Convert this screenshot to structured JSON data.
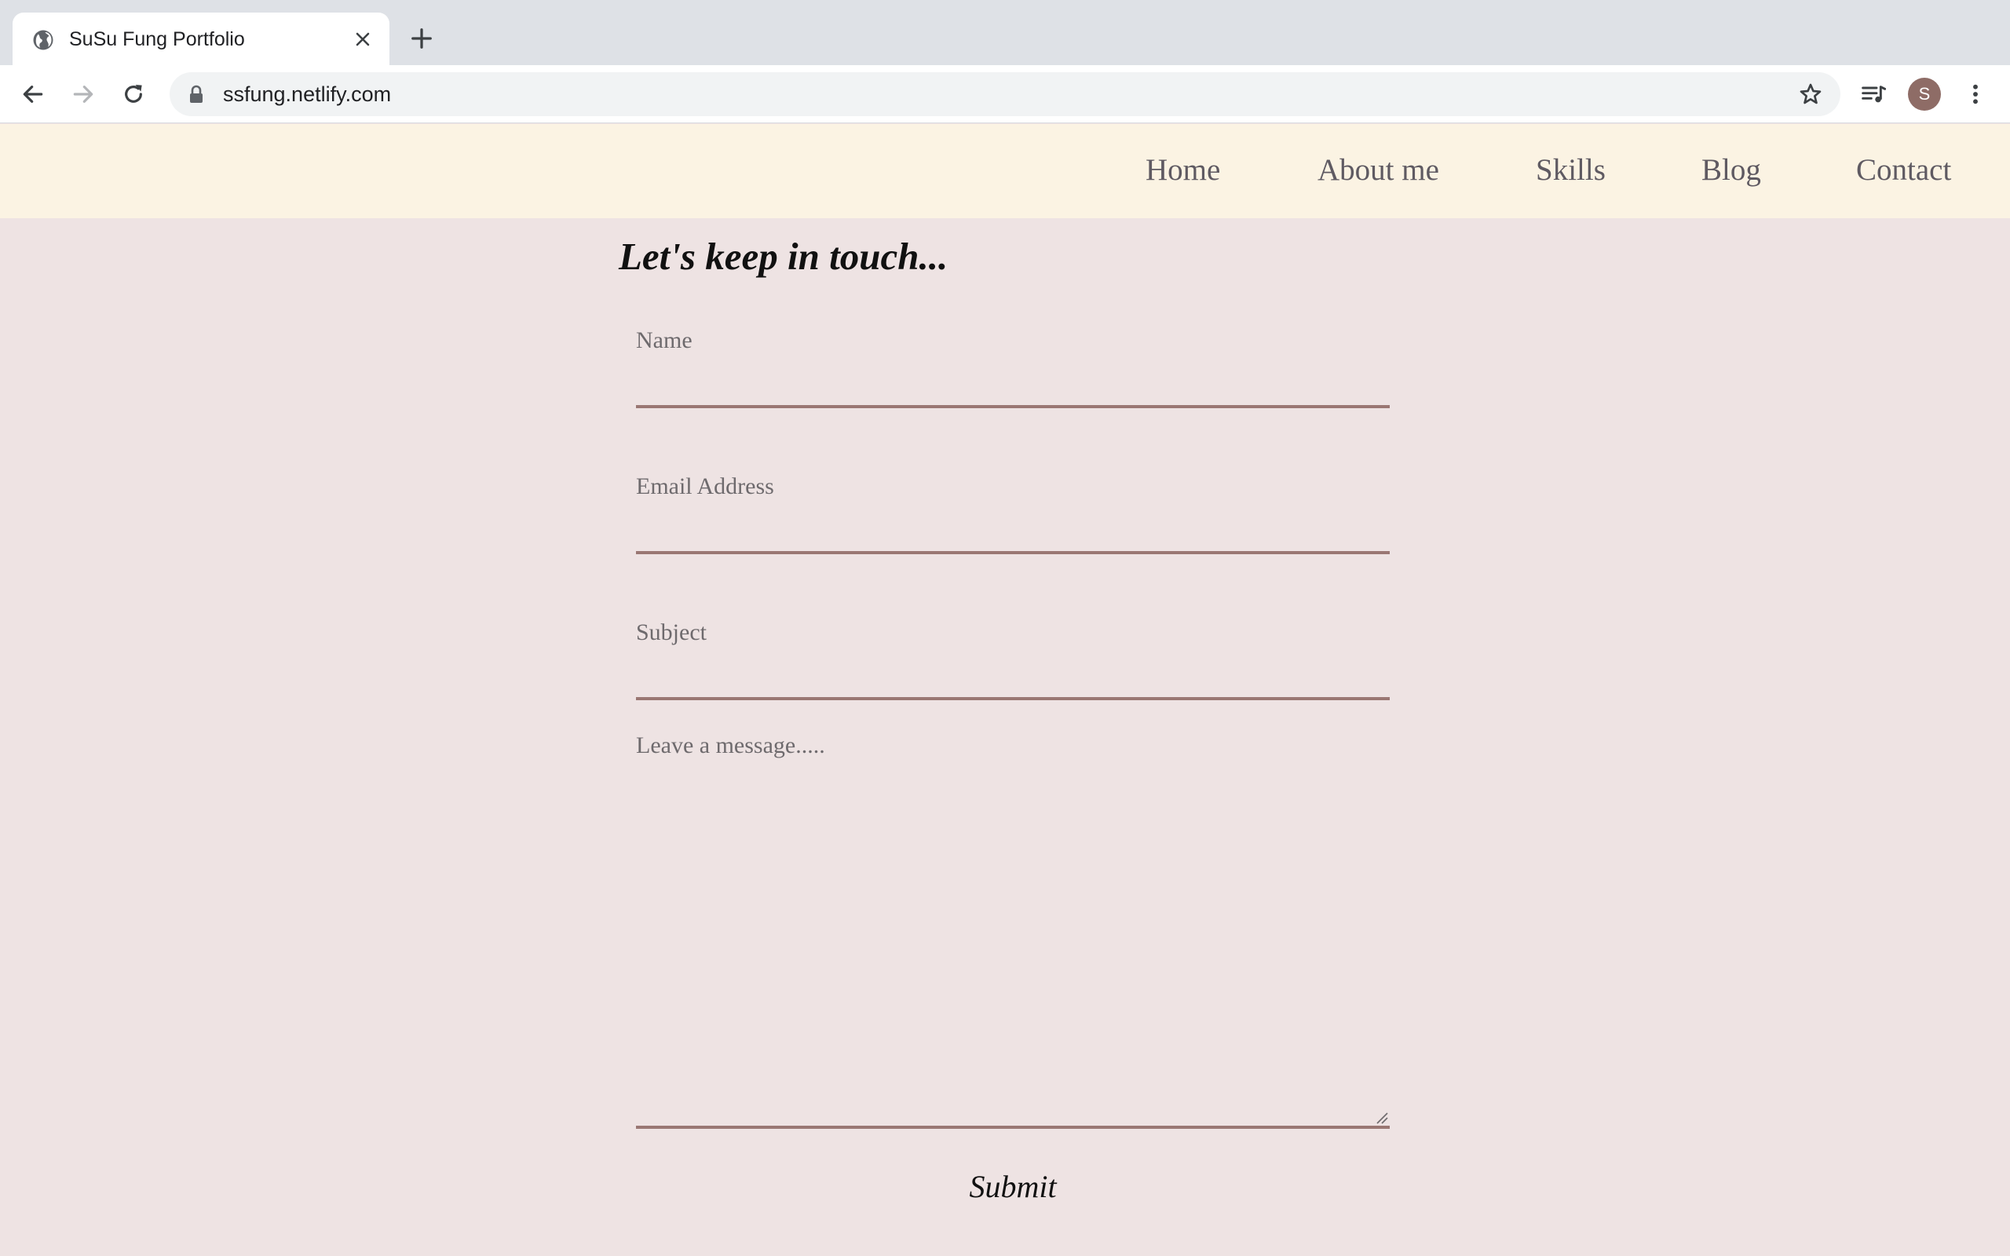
{
  "browser": {
    "tab_title": "SuSu Fung Portfolio",
    "url": "ssfung.netlify.com",
    "profile_initial": "S"
  },
  "nav": {
    "items": [
      {
        "label": "Home"
      },
      {
        "label": "About me"
      },
      {
        "label": "Skills"
      },
      {
        "label": "Blog"
      },
      {
        "label": "Contact"
      }
    ]
  },
  "contact_form": {
    "heading": "Let's keep in touch...",
    "name_label": "Name",
    "email_label": "Email Address",
    "subject_label": "Subject",
    "message_placeholder": "Leave a message.....",
    "submit_label": "Submit"
  },
  "colors": {
    "page_background": "#eee3e3",
    "nav_background": "#fbf3e3",
    "accent_underline": "#9a7773"
  }
}
